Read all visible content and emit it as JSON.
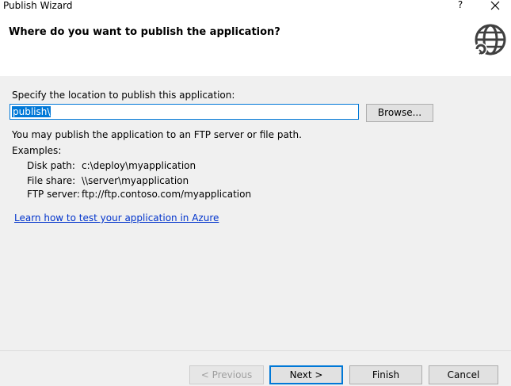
{
  "window": {
    "title": "Publish Wizard",
    "help_label": "?",
    "close_icon": "close-icon"
  },
  "header": {
    "title": "Where do you want to publish the application?",
    "icon": "globe-icon"
  },
  "location": {
    "label": "Specify the location to publish this application:",
    "value": "publish\\",
    "browse_label": "Browse..."
  },
  "info": {
    "text": "You may publish the application to an FTP server or file path.",
    "examples_label": "Examples:",
    "examples": [
      {
        "kind": "Disk path:",
        "value": "c:\\deploy\\myapplication"
      },
      {
        "kind": "File share:",
        "value": "\\\\server\\myapplication"
      },
      {
        "kind": "FTP server:",
        "value": "ftp://ftp.contoso.com/myapplication"
      }
    ]
  },
  "link": {
    "text": "Learn how to test your application in Azure"
  },
  "footer": {
    "previous_label": "< Previous",
    "next_label": "Next >",
    "finish_label": "Finish",
    "cancel_label": "Cancel"
  },
  "colors": {
    "accent": "#0078d7",
    "panel": "#f0f0f0",
    "link": "#0033cc"
  }
}
